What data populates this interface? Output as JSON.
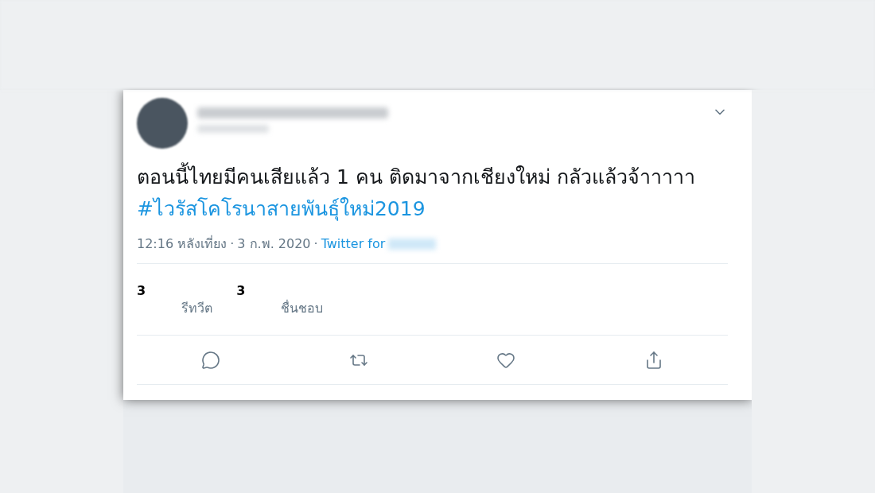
{
  "tweet": {
    "text": "ตอนนี้ไทยมีคนเสียแล้ว 1 คน ติดมาจากเชียงใหม่ กลัวแล้วจ้าาาาา",
    "hashtag": "#ไวรัสโคโรนาสายพันธุ์ใหม่2019",
    "time": "12:16 หลังเที่ยง",
    "date": "3 ก.พ. 2020",
    "source": "Twitter for",
    "separator": "·",
    "stats": [
      {
        "count": "3",
        "label": "รีทวีต"
      },
      {
        "count": "3",
        "label": "ชื่นชอบ"
      }
    ]
  }
}
